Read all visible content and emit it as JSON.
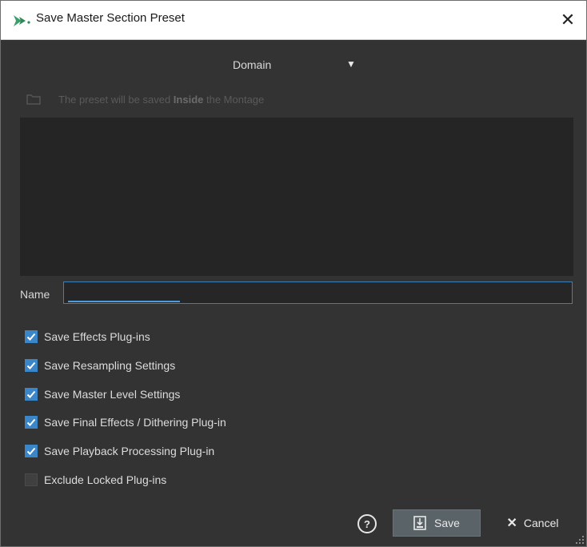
{
  "window": {
    "title": "Save Master Section Preset",
    "close_symbol": "✕"
  },
  "domain": {
    "label": "Domain",
    "arrow": "▼"
  },
  "info": {
    "prefix": "The preset will be saved ",
    "bold": "Inside",
    "suffix": " the Montage"
  },
  "name_field": {
    "label": "Name",
    "value": ""
  },
  "options": [
    {
      "label": "Save Effects Plug-ins",
      "checked": true
    },
    {
      "label": "Save Resampling Settings",
      "checked": true
    },
    {
      "label": "Save Master Level Settings",
      "checked": true
    },
    {
      "label": "Save Final Effects / Dithering Plug-in",
      "checked": true
    },
    {
      "label": "Save Playback Processing Plug-in",
      "checked": true
    },
    {
      "label": "Exclude Locked Plug-ins",
      "checked": false
    }
  ],
  "footer": {
    "help_symbol": "?",
    "save_label": "Save",
    "cancel_label": "Cancel",
    "cancel_symbol": "✕"
  },
  "icons": {
    "title": "app-logo-icon",
    "close": "close-icon",
    "info": "folder-icon",
    "save": "save-icon",
    "help": "help-icon",
    "resize": "resize-grip-icon"
  },
  "colors": {
    "accent": "#3a86c8",
    "background": "#333333",
    "list_background": "#252525"
  }
}
